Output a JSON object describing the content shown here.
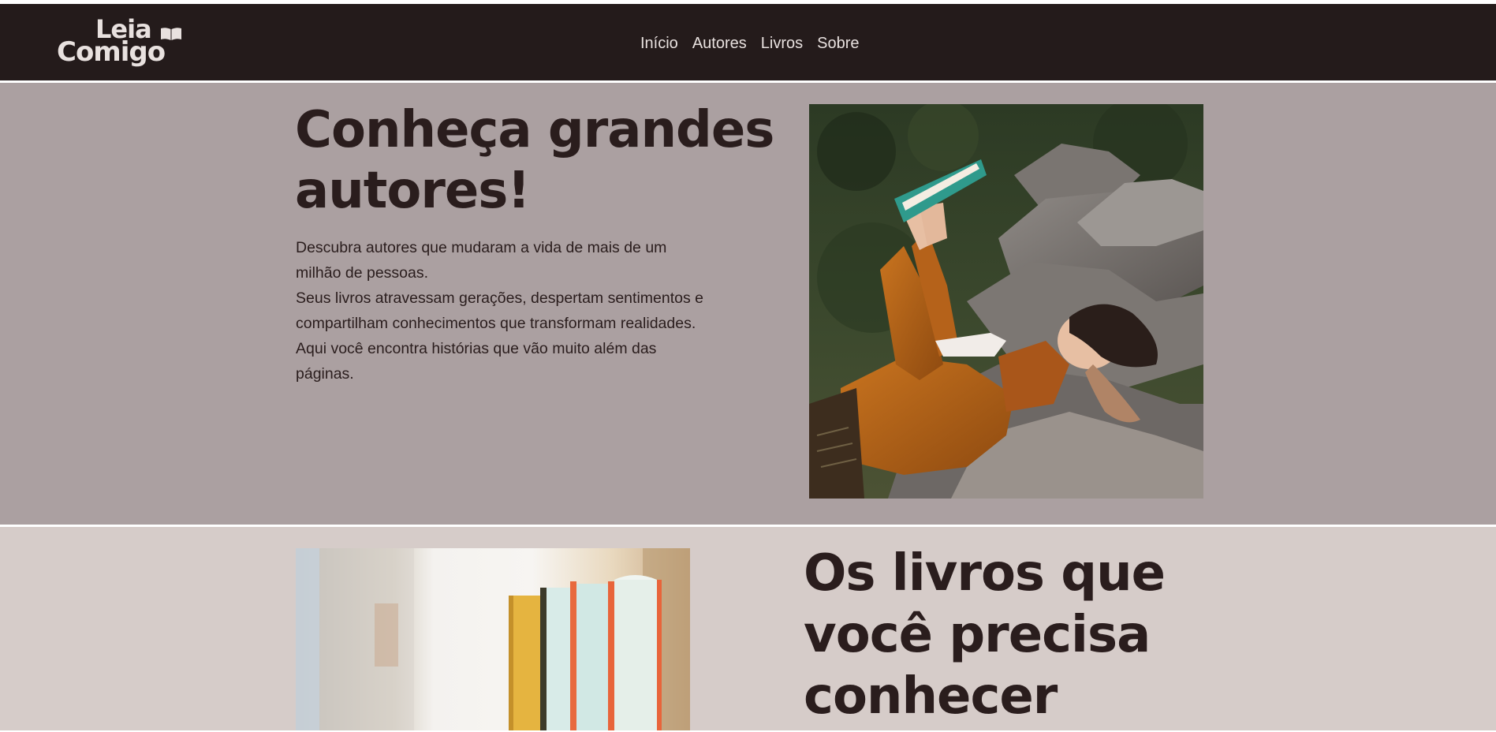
{
  "brand": {
    "logo_line1": "Leia",
    "logo_line2": "Comigo",
    "logo_icon": "open-book-icon"
  },
  "nav": {
    "items": [
      {
        "label": "Início"
      },
      {
        "label": "Autores"
      },
      {
        "label": "Livros"
      },
      {
        "label": "Sobre"
      }
    ]
  },
  "hero": {
    "title": "Conheça grandes autores!",
    "paragraph1": "Descubra autores que mudaram a vida de mais de um milhão de pessoas.",
    "paragraph2": "Seus livros atravessam gerações, despertam sentimentos e compartilham conhecimentos que transformam realidades. Aqui você encontra histórias que vão muito além das páginas.",
    "image": "woman-reading-on-rocks-photo"
  },
  "books_section": {
    "title": "Os livros que você precisa conhecer",
    "image": "books-on-shelf-photo"
  },
  "colors": {
    "header_bg": "#241b1b",
    "hero_bg": "#aba0a1",
    "section2_bg": "#d6ccc9",
    "text_dark": "#2a1d1d",
    "text_light": "#e8e1df"
  }
}
